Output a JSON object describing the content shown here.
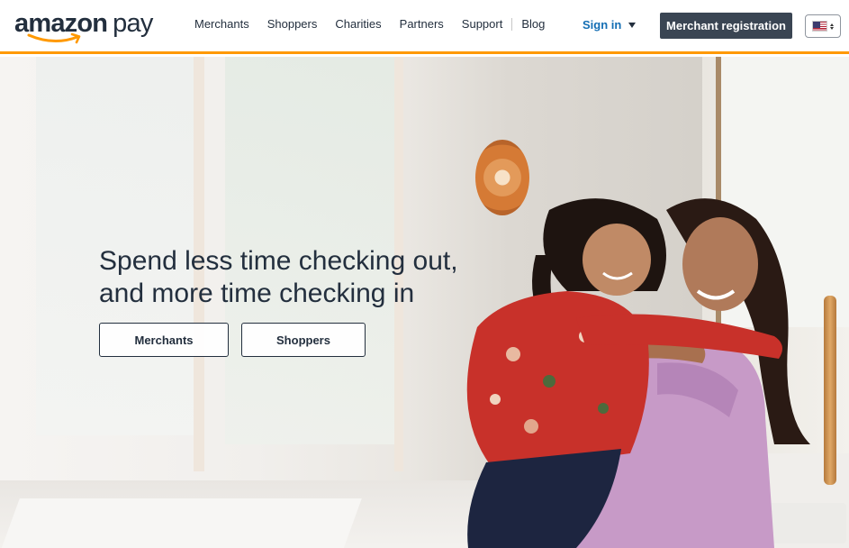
{
  "header": {
    "logo": {
      "word1": "amazon",
      "word2": "pay"
    },
    "nav": [
      {
        "label": "Merchants"
      },
      {
        "label": "Shoppers"
      },
      {
        "label": "Charities"
      },
      {
        "label": "Partners"
      },
      {
        "label": "Support"
      },
      {
        "label": "Blog"
      }
    ],
    "sign_in_label": "Sign in",
    "register_label": "Merchant registration",
    "locale": {
      "icon": "us-flag-icon",
      "value": "US"
    }
  },
  "hero": {
    "headline_line1": "Spend less time checking out,",
    "headline_line2": "and more time checking in",
    "buttons": [
      {
        "label": "Merchants"
      },
      {
        "label": "Shoppers"
      }
    ],
    "image_alt": "Mother hugging her smiling daughter in a bright kitchen"
  },
  "colors": {
    "accent_orange": "#ff9900",
    "brand_navy": "#232f3e",
    "link_blue": "#146eb4",
    "register_button_bg": "#3a4553"
  }
}
